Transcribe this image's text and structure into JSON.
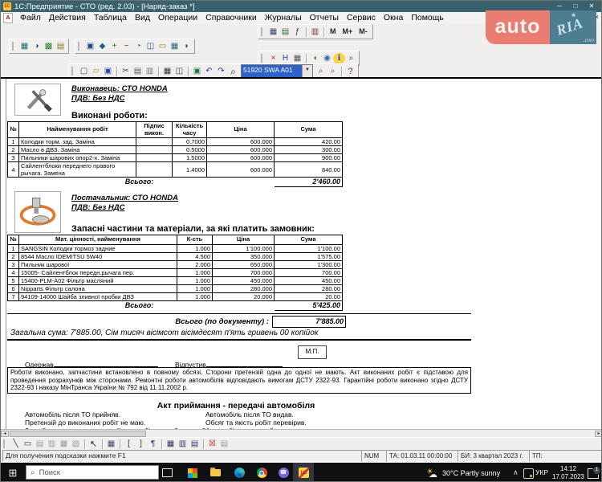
{
  "window": {
    "title": "1С:Предприятие - СТО (ред. 2.03) - [Наряд-заказ *]",
    "app_icon_text": "1С",
    "doc_icon_text": "А",
    "controls": {
      "minimize": "─",
      "maximize": "□",
      "close": "✕",
      "mdi_close": "×"
    },
    "menu": [
      "Файл",
      "Действия",
      "Таблица",
      "Вид",
      "Операции",
      "Справочники",
      "Журналы",
      "Отчеты",
      "Сервис",
      "Окна",
      "Помощь"
    ]
  },
  "watermark": {
    "auto": "auto",
    "ria": "RIA",
    "star": "✶",
    "com": ".com"
  },
  "toolbars": {
    "rowA": [
      {
        "n": "table-settings-icon",
        "g": "▦",
        "c": "#334466"
      },
      {
        "n": "calendar-icon",
        "g": "▤",
        "c": "#336633"
      },
      {
        "n": "formula-icon",
        "g": "ƒ",
        "c": "#333333"
      },
      {
        "s": 1
      },
      {
        "n": "book-icon",
        "g": "▥",
        "c": "#663333"
      },
      {
        "s": 1
      },
      {
        "n": "memory-recall-button",
        "t": "М"
      },
      {
        "n": "memory-add-button",
        "t": "М+"
      },
      {
        "n": "memory-subtract-button",
        "t": "М-"
      }
    ],
    "rowB1": [
      {
        "n": "catalog-icon",
        "g": "▦",
        "c": "#1b6e6e"
      },
      {
        "n": "operations-icon",
        "g": "◑",
        "c": "#224488"
      },
      {
        "n": "components-icon",
        "g": "▩",
        "c": "#2a7a2a"
      },
      {
        "n": "money-icon",
        "g": "▤",
        "c": "#8a7a1a"
      }
    ],
    "rowB2": [
      {
        "n": "documents-icon",
        "g": "▣",
        "c": "#224488"
      },
      {
        "n": "reference-icon",
        "g": "◆",
        "c": "#1b5e8e"
      },
      {
        "n": "add-icon",
        "g": "+",
        "c": "#1b6e2e"
      },
      {
        "n": "remove-icon",
        "g": "−",
        "c": "#8e2222"
      },
      {
        "n": "clock-icon",
        "g": "◔",
        "c": "#224488"
      },
      {
        "n": "structure-icon",
        "g": "◫",
        "c": "#1b5e8e"
      },
      {
        "n": "mail-icon",
        "g": "▭",
        "c": "#8a7a1a"
      },
      {
        "n": "grid-icon",
        "g": "▦",
        "c": "#1b6e6e"
      },
      {
        "n": "export-icon",
        "g": "◗",
        "c": "#224488"
      }
    ],
    "rowC": [
      {
        "n": "exit-icon",
        "g": "×",
        "c": "#b02020"
      },
      {
        "n": "history-icon",
        "g": "Н",
        "c": "#223f8f"
      },
      {
        "n": "table-grid-icon",
        "g": "▦",
        "c": "#555555"
      },
      {
        "s": 1
      },
      {
        "n": "rainbow-icon",
        "g": "◖",
        "c": "#2a8a2a"
      },
      {
        "n": "globe-icon",
        "g": "◉",
        "c": "#2a6a9a"
      },
      {
        "n": "info-icon",
        "g": "ℹ",
        "c": "#0a58c0",
        "b": "#ffd34d"
      },
      {
        "n": "zoom-icon",
        "g": "⌕",
        "c": "#333333"
      }
    ],
    "rowD1": [
      {
        "n": "new-document-icon",
        "g": "▢",
        "c": "#444444"
      },
      {
        "n": "open-icon",
        "g": "▱",
        "c": "#b8860b"
      },
      {
        "n": "save-icon",
        "g": "▣",
        "c": "#2a4a9a"
      },
      {
        "s": 1
      },
      {
        "n": "cut-icon",
        "g": "✂",
        "c": "#444444"
      },
      {
        "n": "copy-icon",
        "g": "▤",
        "c": "#555555"
      },
      {
        "n": "paste-icon",
        "g": "▥",
        "c": "#777777"
      },
      {
        "s": 1
      },
      {
        "n": "print-icon",
        "g": "▦",
        "c": "#333333"
      },
      {
        "n": "print-preview-icon",
        "g": "◫",
        "c": "#333333"
      },
      {
        "s": 1
      },
      {
        "n": "calculator-icon",
        "g": "▣",
        "c": "#1b7a4a"
      },
      {
        "n": "undo-icon",
        "g": "↶",
        "c": "#22408f"
      },
      {
        "n": "redo-icon",
        "g": "↷",
        "c": "#22408f"
      },
      {
        "n": "find-icon",
        "g": "⌕",
        "c": "#111111",
        "f": "12"
      }
    ],
    "combo_value": "51920 SWA A01",
    "combo_arrow": "▼",
    "rowD2": [
      {
        "n": "find-next-icon",
        "g": "⌕",
        "c": "#6a3a8a"
      },
      {
        "n": "find-settings-icon",
        "g": "⌕",
        "c": "#3a6a3a"
      },
      {
        "s": 1
      },
      {
        "n": "help-icon",
        "g": "?",
        "c": "#5a2a8a",
        "f": "11"
      }
    ],
    "rowBottom": [
      {
        "n": "draw-line-icon",
        "g": "╲",
        "c": "#333333"
      },
      {
        "n": "draw-rect-icon",
        "g": "▭",
        "c": "#333333"
      },
      {
        "n": "picture-icon",
        "g": "▤",
        "c": "#9a9a9a"
      },
      {
        "n": "picture2-icon",
        "g": "▥",
        "c": "#9a9a9a"
      },
      {
        "n": "picture3-icon",
        "g": "▦",
        "c": "#9a9a9a"
      },
      {
        "n": "picture4-icon",
        "g": "▧",
        "c": "#9a9a9a"
      },
      {
        "s": 1
      },
      {
        "n": "pointer-icon",
        "g": "↖",
        "c": "#222222",
        "f": "11"
      },
      {
        "s": 1
      },
      {
        "n": "grid-toggle-icon",
        "g": "▦",
        "c": "#444466"
      },
      {
        "s": 1
      },
      {
        "n": "bracket-open-icon",
        "g": "[",
        "c": "#333333"
      },
      {
        "n": "bracket-close-icon",
        "g": "]",
        "c": "#333333"
      },
      {
        "n": "paragraph-icon",
        "g": "¶",
        "c": "#333366"
      },
      {
        "s": 1
      },
      {
        "n": "table-icon",
        "g": "▦",
        "c": "#333366"
      },
      {
        "n": "insert-column-icon",
        "g": "▥",
        "c": "#333366"
      },
      {
        "n": "insert-row-icon",
        "g": "▤",
        "c": "#333366"
      },
      {
        "s": 1
      },
      {
        "n": "delete-table-icon",
        "g": "☒",
        "c": "#b02020"
      },
      {
        "n": "merge-cells-icon",
        "g": "▤",
        "c": "#9a9a9a"
      }
    ]
  },
  "document": {
    "executor_title": "Виконавець:   СТО  HONDA",
    "executor_vat": "ПДВ: Без НДС",
    "works_title": "Виконані роботи:",
    "works_table": {
      "headers": [
        "№",
        "Найменування робіт",
        "Підпис викон.",
        "Кількість часу",
        "Ціна",
        "Сума"
      ],
      "rows": [
        [
          "1",
          "Колодки торм. зад. Заміна",
          "",
          "0.7000",
          "600.000",
          "420.00"
        ],
        [
          "2",
          "Масло в ДВЗ. Заміна",
          "",
          "0.5000",
          "600.000",
          "300.00"
        ],
        [
          "3",
          "Пильники шарових опор2-х. Заміна",
          "",
          "1.5000",
          "600.000",
          "900.00"
        ],
        [
          "4",
          "Сайлентблоки переднего правого рычага. Замена",
          "",
          "1.4000",
          "600.000",
          "840.00"
        ]
      ],
      "total_label": "Всього:",
      "total": "2'460.00"
    },
    "supplier_title": "Постачальник:   СТО  HONDA",
    "supplier_vat": "ПДВ: Без НДС",
    "parts_title": "Запасні частини та матеріали, за які платить замовник:",
    "parts_table": {
      "headers": [
        "№",
        "Мат. цінності, найменування",
        "К-сть",
        "Ціна",
        "Сума"
      ],
      "rows": [
        [
          "1",
          "SANGSIN Колодки тормоз задние",
          "1.000",
          "1'100.000",
          "1'100.00"
        ],
        [
          "2",
          "8544 Масло IDEMITSU 5W40",
          "4.500",
          "350.000",
          "1'575.00"
        ],
        [
          "3",
          "Пильник шарової",
          "2.000",
          "650.000",
          "1'300.00"
        ],
        [
          "4",
          "15005- Сайлентблок передн.рычага пер.",
          "1.000",
          "700.000",
          "700.00"
        ],
        [
          "5",
          "15400-PLM-A02 Фільтр масляний",
          "1.000",
          "450.000",
          "450.00"
        ],
        [
          "6",
          "Nipparts Фільтр салона",
          "1.000",
          "280.000",
          "280.00"
        ],
        [
          "7",
          "94109-14000 Шайба зливної пробки ДВЗ",
          "1.000",
          "20.000",
          "20.00"
        ]
      ],
      "total_label": "Всього:",
      "total": "5'425.00"
    },
    "doc_total_label": "Всього (по документу) :",
    "doc_total": "7'885.00",
    "amount_words": "Загальна сума:  7'885.00, Сім тисяч вісімсот вісімдесят п'ять гривень 00 копійок",
    "stamp": "М.П.",
    "received": "Одержав",
    "released": "Відпустив",
    "disclaimer": "Роботи виконано, запчастини встановлено в повному обсязі. Сторони претензій одна до одної не мають. Акт виконаних робіт є підставою для проведення розрахунків між сторонами. Ремонтні роботи автомобілів відповідають вимогам ДСТУ 2322-93. Гарантійні роботи виконано згідно ДСТУ 2322-93 і наказу МінТранса України № 792 від 11.11.2002 р.",
    "act_title": "Акт приймання - передачі автомобіля",
    "act_left": [
      "Автомобіль після ТО прийняв.",
      "Претензій до виконаних робіт не маю.",
      "З особливостями експлуатації автомобіля ознайомлений."
    ],
    "act_right": [
      "Автомобіль після ТО видав.",
      "Обсяг та якість робіт перевірив.",
      "Автомобіль справний."
    ]
  },
  "scrollbar": {
    "left_arrow": "◂",
    "right_arrow": "▸"
  },
  "statusbar": {
    "hint": "Для получения подсказки нажмите F1",
    "num": "NUM",
    "ta": "ТА: 01.03.11  00:00:00",
    "bi": "БИ: 3 квартал 2023 г.",
    "tp": "ТП:"
  },
  "taskbar": {
    "start": "⊞",
    "search_icon": "⌕",
    "search_placeholder": "Поиск",
    "weather": "30°C  Partly sunny",
    "chevron": "∧",
    "lang": "УКР",
    "time": "14:12",
    "date": "17.07.2023",
    "badge": "1",
    "onec_label": "1С",
    "viber_glyph": "☎"
  }
}
